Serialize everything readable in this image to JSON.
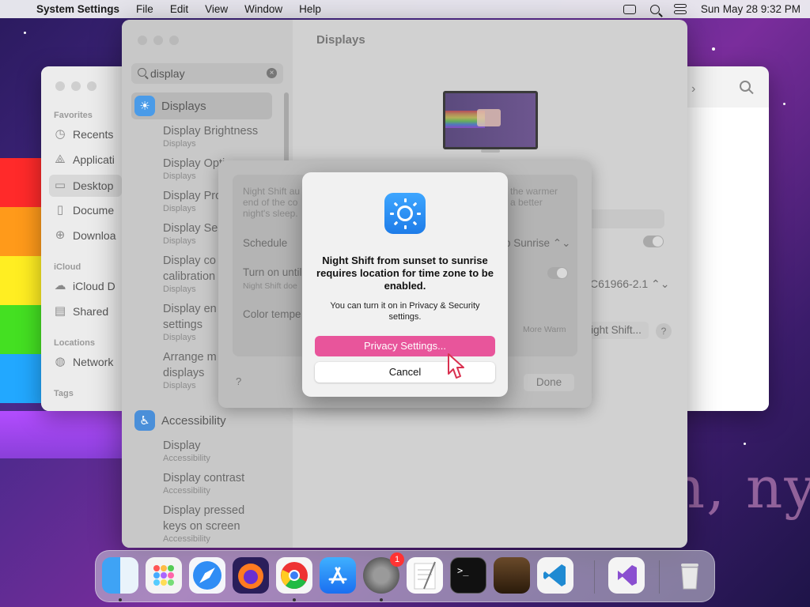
{
  "menubar": {
    "app_name": "System Settings",
    "items": [
      "File",
      "Edit",
      "View",
      "Window",
      "Help"
    ],
    "clock": "Sun May 28  9:32 PM"
  },
  "finder": {
    "sections": {
      "favorites": "Favorites",
      "icloud": "iCloud",
      "locations": "Locations",
      "tags": "Tags"
    },
    "items": {
      "recents": "Recents",
      "applications": "Applicati",
      "desktop": "Desktop",
      "documents": "Docume",
      "downloads": "Downloa",
      "icloud_drive": "iCloud D",
      "shared": "Shared",
      "network": "Network"
    }
  },
  "settings": {
    "title": "Displays",
    "search_value": "display",
    "sidebar": {
      "displays_label": "Displays",
      "results": [
        {
          "title": "Display Brightness",
          "sub": "Displays"
        },
        {
          "title": "Display Opti",
          "sub": "Displays"
        },
        {
          "title": "Display Pro",
          "sub": "Displays"
        },
        {
          "title": "Display Se",
          "sub": "Displays"
        },
        {
          "title": "Display co",
          "title2": "calibration",
          "sub": "Displays"
        },
        {
          "title": "Display en",
          "title2": "settings",
          "sub": "Displays"
        },
        {
          "title": "Arrange m",
          "title2": "displays",
          "sub": "Displays"
        }
      ],
      "accessibility_label": "Accessibility",
      "accessibility_results": [
        {
          "title": "Display",
          "sub": "Accessibility"
        },
        {
          "title": "Display contrast",
          "sub": "Accessibility"
        },
        {
          "title": "Display pressed",
          "title2": "keys on screen",
          "sub": "Accessibility"
        }
      ]
    },
    "right": {
      "display_model": "C61966-2.1",
      "night_shift_button": "ight Shift...",
      "help": "?"
    }
  },
  "night_shift_sheet": {
    "desc_left_1": "Night Shift au",
    "desc_left_2": "end of the co",
    "desc_left_3": "night's sleep.",
    "desc_right_1": "the warmer",
    "desc_right_2": "a better",
    "schedule_label": "Schedule",
    "schedule_value": "o Sunrise",
    "turn_on_label": "Turn on until",
    "turn_on_sub": "Night Shift doe",
    "color_temp_label": "Color tempe",
    "more_warm": "More Warm",
    "help": "?",
    "done_label": "Done"
  },
  "alert": {
    "title": "Night Shift from sunset to sunrise requires location for time zone to be enabled.",
    "message": "You can turn it on in Privacy & Security settings.",
    "primary_button": "Privacy Settings...",
    "secondary_button": "Cancel"
  },
  "dock": {
    "settings_badge": "1"
  }
}
